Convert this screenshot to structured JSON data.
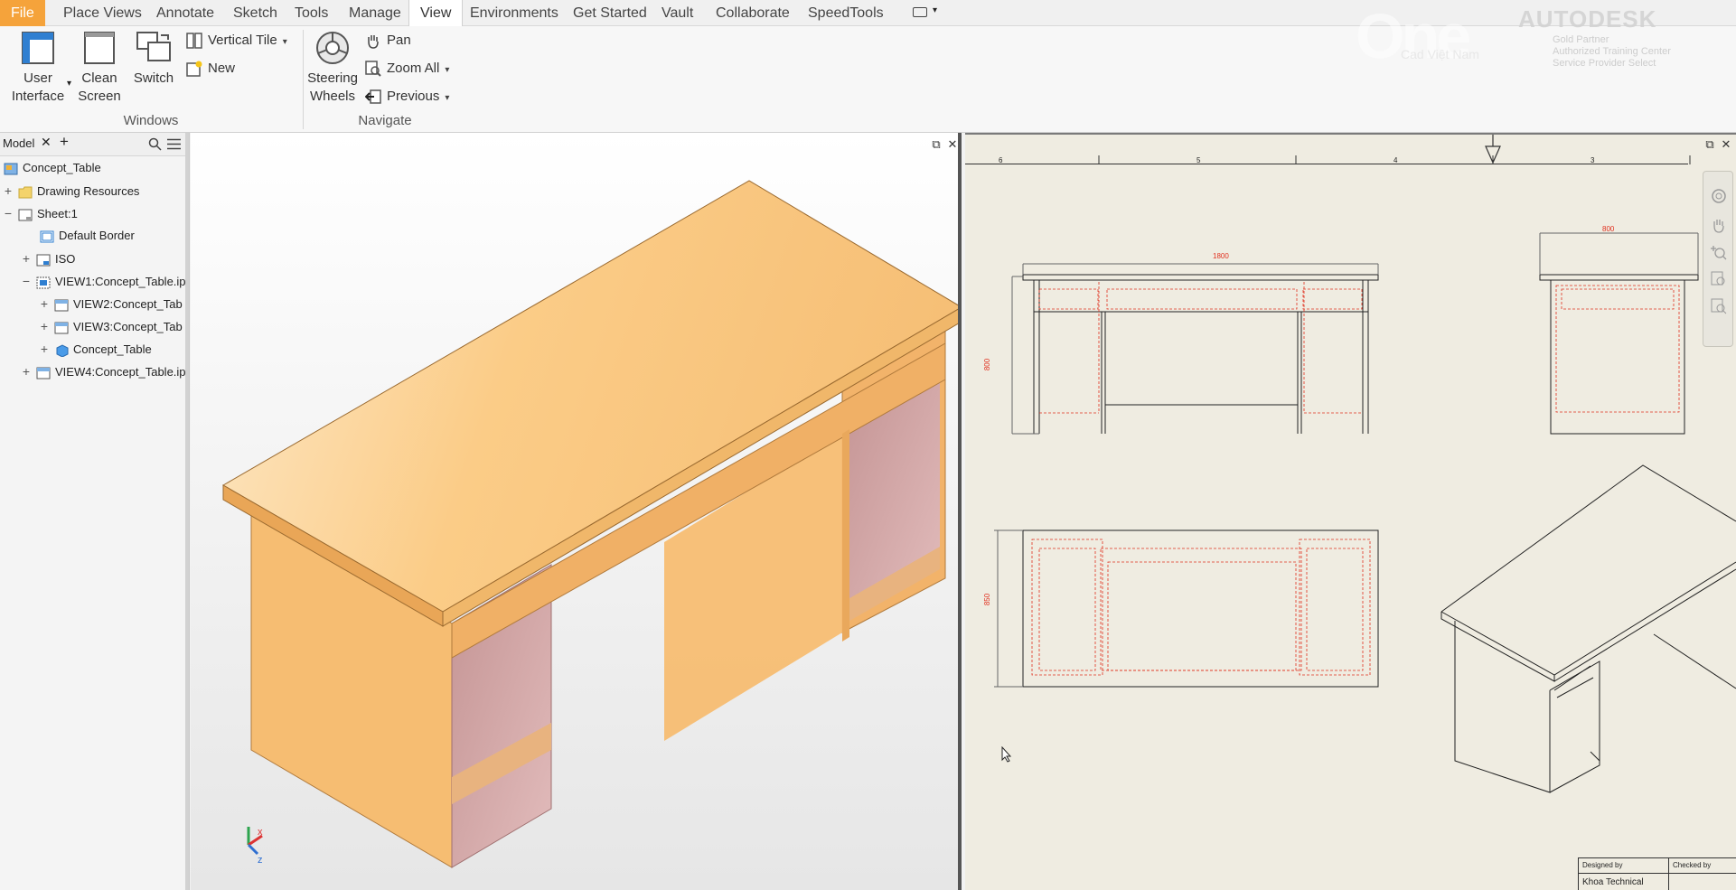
{
  "menu": {
    "tabs": [
      "File",
      "Place Views",
      "Annotate",
      "Sketch",
      "Tools",
      "Manage",
      "View",
      "Environments",
      "Get Started",
      "Vault",
      "Collaborate",
      "SpeedTools"
    ],
    "active": "View"
  },
  "ribbon": {
    "windows": {
      "user_interface": "User\nInterface",
      "clean_screen": "Clean\nScreen",
      "switch": "Switch",
      "vertical_tile": "Vertical Tile",
      "new": "New",
      "group": "Windows"
    },
    "navigate": {
      "steering": "Steering\nWheels",
      "pan": "Pan",
      "zoom_all": "Zoom All",
      "previous": "Previous",
      "group": "Navigate"
    }
  },
  "brand": {
    "one": "One",
    "cad": "Cad Việt Nam",
    "autodesk": "AUTODESK",
    "partner": [
      "Gold Partner",
      "Authorized Training Center",
      "Service Provider Select"
    ]
  },
  "browser": {
    "tab": "Model",
    "items": [
      {
        "label": "Concept_Table",
        "indent": 0,
        "pm": ""
      },
      {
        "label": "Drawing Resources",
        "indent": 0,
        "pm": "+"
      },
      {
        "label": "Sheet:1",
        "indent": 0,
        "pm": "−"
      },
      {
        "label": "Default Border",
        "indent": 1,
        "pm": ""
      },
      {
        "label": "ISO",
        "indent": 1,
        "pm": "+"
      },
      {
        "label": "VIEW1:Concept_Table.ip",
        "indent": 1,
        "pm": "−"
      },
      {
        "label": "VIEW2:Concept_Tab",
        "indent": 2,
        "pm": "+"
      },
      {
        "label": "VIEW3:Concept_Tab",
        "indent": 2,
        "pm": "+"
      },
      {
        "label": "Concept_Table",
        "indent": 2,
        "pm": "+"
      },
      {
        "label": "VIEW4:Concept_Table.ip",
        "indent": 1,
        "pm": "+"
      }
    ]
  },
  "drawing": {
    "ruler": [
      "6",
      "5",
      "4",
      "3"
    ],
    "dim_front_width": "1800",
    "dim_side_width": "800",
    "dim_front_height": "800",
    "dim_top_depth": "850",
    "titleblock": {
      "designed_by": "Designed by",
      "checked_by": "Checked by",
      "designer": "Khoa Technical"
    }
  },
  "colors": {
    "accent": "#f5a33b",
    "wood": "#f6c07e",
    "drawer": "#cfa5a4",
    "dims": "#e0301e"
  }
}
